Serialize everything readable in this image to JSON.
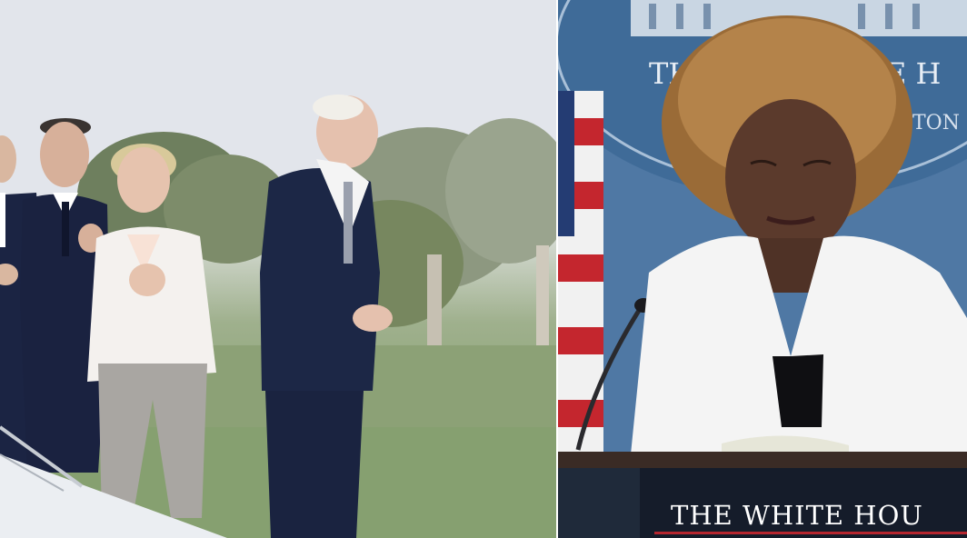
{
  "scene": {
    "left_panel": {
      "setting": "outdoor",
      "people_visible": 4
    },
    "right_panel": {
      "setting": "press-briefing-room",
      "lectern_text": "THE WHITE HOU",
      "seal_text_fragment_1": "TH",
      "seal_text_fragment_2": "E H",
      "seal_text_fragment_3": "TON"
    }
  },
  "colors": {
    "sky": "#e2e5eb",
    "grass": "#8ca176",
    "suit_navy": "#1c2746",
    "white_jacket": "#f4f1ee",
    "briefing_blue": "#4f78a4",
    "lectern_dark": "#1f2a3a",
    "lectern_red_line": "#b5262f"
  }
}
